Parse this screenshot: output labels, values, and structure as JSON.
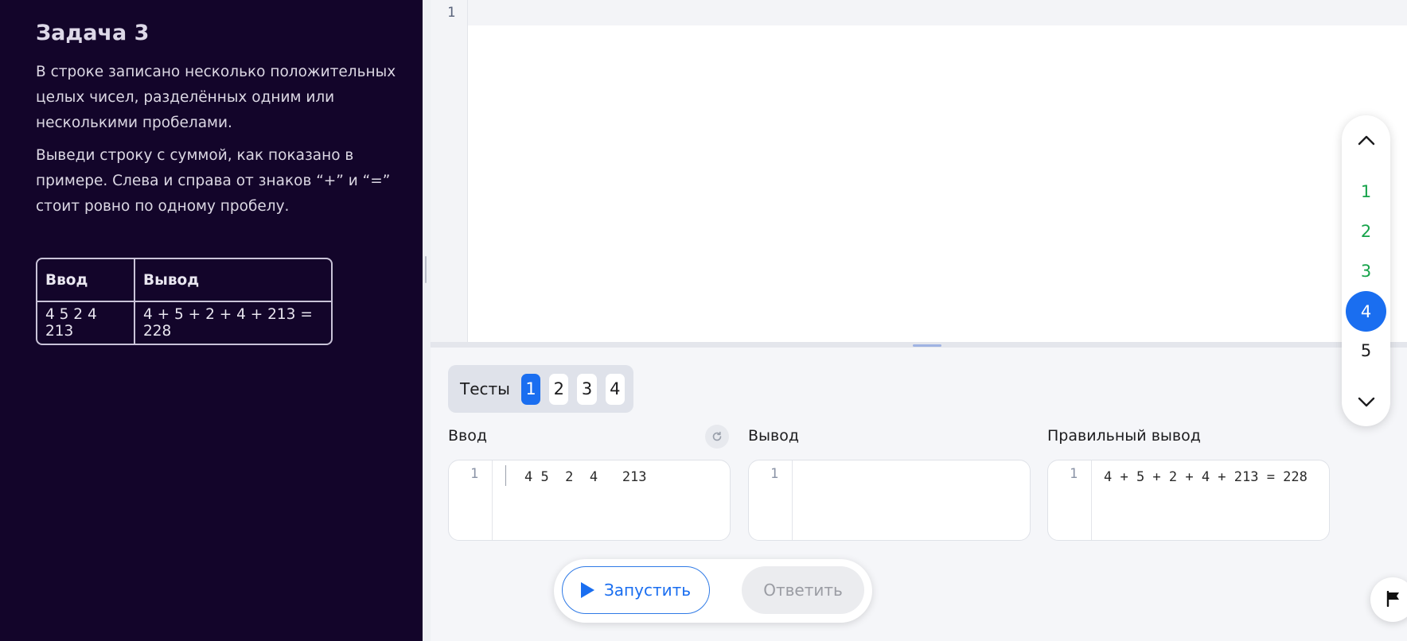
{
  "task": {
    "title": "Задача 3",
    "paragraphs": [
      "В строке записано несколько положительных целых чисел, разделённых одним или несколькими пробелами.",
      "Выведи строку с суммой, как показано в примере. Слева и справа от знаков “+” и “=” стоит ровно по одному пробелу."
    ],
    "example": {
      "headers": [
        "Ввод",
        "Вывод"
      ],
      "rows": [
        [
          "4 5 2 4 213",
          "4 + 5 + 2 + 4 + 213 = 228"
        ]
      ]
    }
  },
  "editor": {
    "line_numbers": [
      "1"
    ],
    "code": ""
  },
  "tests": {
    "label": "Тесты",
    "items": [
      "1",
      "2",
      "3",
      "4"
    ],
    "active": "1"
  },
  "io": {
    "input": {
      "label": "Ввод",
      "line": "1",
      "value": "4 5  2  4   213"
    },
    "output": {
      "label": "Вывод",
      "line": "1",
      "value": ""
    },
    "expected": {
      "label": "Правильный вывод",
      "line": "1",
      "value": "4 + 5 + 2 + 4 + 213 = 228"
    }
  },
  "actions": {
    "run": "Запустить",
    "answer": "Ответить"
  },
  "task_nav": {
    "items": [
      {
        "label": "1",
        "state": "done"
      },
      {
        "label": "2",
        "state": "done"
      },
      {
        "label": "3",
        "state": "done"
      },
      {
        "label": "4",
        "state": "current"
      },
      {
        "label": "5",
        "state": "pending"
      }
    ]
  },
  "colors": {
    "accent": "#1a6ef0",
    "done": "#16a34a",
    "panel_bg": "#13052a"
  },
  "icons": {
    "up": "chevron-up-icon",
    "down": "chevron-down-icon",
    "reset": "reset-icon",
    "play": "play-icon",
    "flag": "flag-icon"
  }
}
